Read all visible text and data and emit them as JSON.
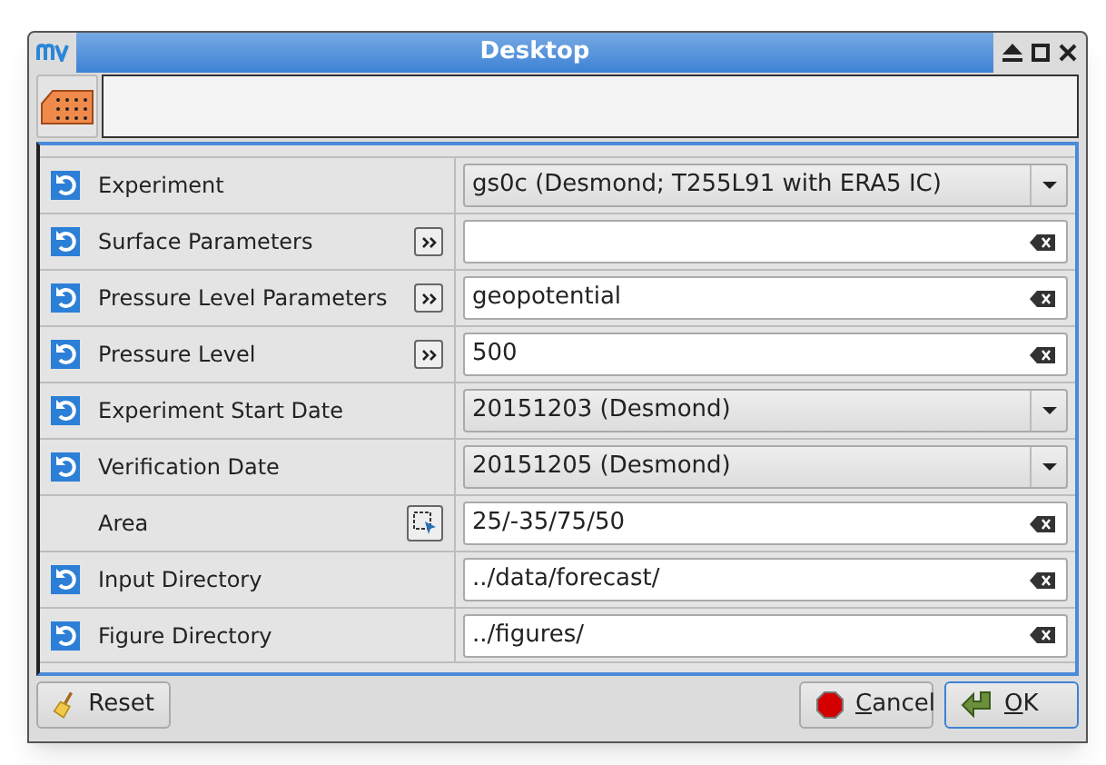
{
  "window": {
    "title": "Desktop"
  },
  "rows": [
    {
      "label": "Experiment",
      "reset": true,
      "kind": "combo",
      "value": "gs0c (Desmond; T255L91 with ERA5 IC)"
    },
    {
      "label": "Surface Parameters",
      "reset": true,
      "helper": {
        "kind": "list"
      },
      "kind": "entry",
      "value": ""
    },
    {
      "label": "Pressure Level Parameters",
      "reset": true,
      "helper": {
        "kind": "list"
      },
      "kind": "entry",
      "value": "geopotential"
    },
    {
      "label": "Pressure Level",
      "reset": true,
      "helper": {
        "kind": "list"
      },
      "kind": "entry",
      "value": "500"
    },
    {
      "label": "Experiment Start Date",
      "reset": true,
      "kind": "combo",
      "value": "20151203 (Desmond)"
    },
    {
      "label": "Verification Date",
      "reset": true,
      "kind": "combo",
      "value": "20151205 (Desmond)"
    },
    {
      "label": "Area",
      "reset": false,
      "helper": {
        "kind": "area"
      },
      "kind": "entry",
      "value": "25/-35/75/50"
    },
    {
      "label": "Input Directory",
      "reset": true,
      "kind": "entry",
      "value": "../data/forecast/"
    },
    {
      "label": "Figure Directory",
      "reset": true,
      "kind": "entry",
      "value": "../figures/"
    }
  ],
  "buttons": [
    {
      "label": "Reset",
      "kind": "reset",
      "mnemonic": false,
      "focused": false
    },
    {
      "label": "Cancel",
      "kind": "cancel",
      "mnemonic": true,
      "focused": false
    },
    {
      "label": "OK",
      "kind": "ok",
      "mnemonic": true,
      "focused": true
    }
  ]
}
